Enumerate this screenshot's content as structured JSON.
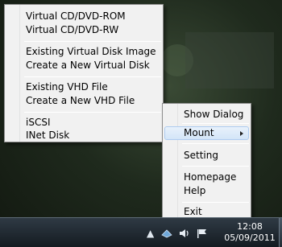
{
  "submenu": {
    "items": [
      {
        "label": "Virtual CD/DVD-ROM"
      },
      {
        "label": "Virtual CD/DVD-RW"
      },
      {
        "label": "Existing Virtual Disk Image"
      },
      {
        "label": "Create a New Virtual Disk"
      },
      {
        "label": "Existing VHD File"
      },
      {
        "label": "Create a New VHD File"
      },
      {
        "label": "iSCSI"
      },
      {
        "label": "INet Disk"
      }
    ]
  },
  "main_menu": {
    "items": [
      {
        "label": "Show Dialog"
      },
      {
        "label": "Mount",
        "has_submenu": true,
        "selected": true
      },
      {
        "label": "Setting"
      },
      {
        "label": "Homepage"
      },
      {
        "label": "Help"
      },
      {
        "label": "Exit"
      }
    ]
  },
  "taskbar": {
    "tray_icons": [
      "show-hidden-icons-arrow-icon",
      "network-icon",
      "volume-icon",
      "action-center-flag-icon"
    ],
    "clock": {
      "time": "12:08",
      "date": "05/09/2011"
    }
  },
  "colors": {
    "menu_bg": "#f1f1f1",
    "highlight": "#d3e5f8",
    "highlight_border": "#aeccf0",
    "taskbar": "#1c252c"
  }
}
